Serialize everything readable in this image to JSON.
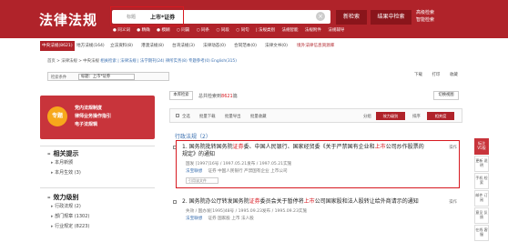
{
  "header": {
    "logo": "法律法规",
    "search_label": "标题",
    "search_value": "上市*证券",
    "clear": "×",
    "search_button": "新检索",
    "insearch_button": "结果中检索",
    "advanced": [
      "高级检索",
      "智能检索"
    ],
    "options": [
      "● 同义词",
      "● 精确",
      "● 模糊",
      "○ 同篇",
      "○ 同条",
      "○ 同段",
      "○ 同句",
      "| 法规类别",
      "法规智能",
      "法规附件",
      "法规辅导"
    ]
  },
  "nav": {
    "tabs": [
      "中央法规(8621)",
      "地方法规(164)",
      "立法资料(8)",
      "港澳法规(8)",
      "台湾法规(3)",
      "法律动态(0)",
      "合同范本(0)",
      "法律文书(0)"
    ],
    "hot": "境外法律信息资源库"
  },
  "breadcrumb": {
    "home": "首页 > 法律法规 > 中央法规",
    "links": "相关检索 | 法律法规 | 法学期刊(24) 律所实务(8) 专题参考(0) English(315)"
  },
  "filter": {
    "label": "检索条件",
    "value": "标题：上市*证券"
  },
  "toolbar_right": [
    "下载",
    "打印",
    "收藏"
  ],
  "banner": {
    "circle": "专题",
    "lines": [
      "党内法规制度",
      "律师业务操作指引",
      "电子法规辑"
    ]
  },
  "sidebar": {
    "sections": [
      {
        "title": "相关提示",
        "items": [
          "本月新颁",
          "本月生效 (3)"
        ]
      },
      {
        "title": "效力级别",
        "items": [
          "行政法规 (2)",
          "部门规章 (1302)",
          "行业规定 (8223)"
        ]
      }
    ]
  },
  "main": {
    "sort_tab": "本库检索",
    "total_prefix": "总共检索到",
    "total_count": "8621",
    "total_suffix": "篇",
    "switch": "切换视图",
    "toolbar": {
      "select_all": "全选",
      "download": "批量下载",
      "export": "批量导出",
      "favorite": "批量收藏",
      "group": "分组",
      "group_value": "效力级别",
      "sort": "排序",
      "sort_value": "相关度"
    },
    "section_title": "行政法规（2）",
    "results": [
      {
        "title_a": "1. 国务院批转国务院",
        "title_b": "证券",
        "title_c": "委、中国人民银行、国家经贸委《关于严禁国有企业和",
        "title_d": "上市",
        "title_e": "公司炒作股票的规定》的通知",
        "meta": "国发 [1997]16号 / 1997.05.21发布 / 1997.05.21实施",
        "tags_label": "法宝联想",
        "tags": [
          "证券",
          "中国人民银行",
          "严禁国有企业",
          "上市公司"
        ],
        "tag_btn": "引用该文件",
        "action": "操作"
      },
      {
        "title_a": "2. 国务院办公厅转发国务院",
        "title_b": "证券",
        "title_c": "委员会关于暂停将",
        "title_d": "上市",
        "title_e": "公司国家股和法人股转让给外商请示的通知",
        "meta": "失效 / 国办发[1995]48号 / 1995.09.23发布 / 1995.09.23实施",
        "tags_label": "法宝联想",
        "tags": [
          "证券",
          "国家股",
          "上市",
          "法人股"
        ],
        "tag_btn": "",
        "action": "操作"
      }
    ]
  },
  "rightrail": [
    "标注 V5版",
    "更新 说明",
    "手机 检索",
    "邮件 订阅",
    "意见 反馈",
    "在线 客服"
  ]
}
